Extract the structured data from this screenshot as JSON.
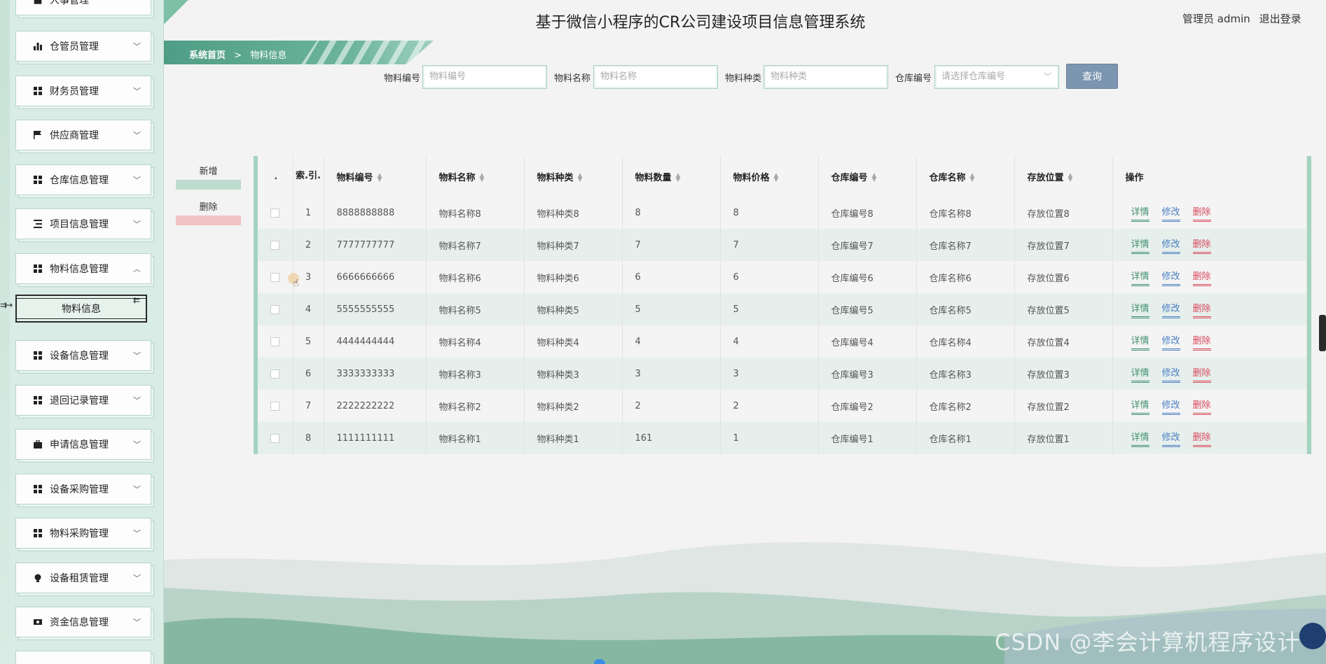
{
  "header": {
    "title": "基于微信小程序的CR公司建设项目信息管理系统",
    "user_label": "管理员 admin",
    "logout_label": "退出登录"
  },
  "breadcrumb": {
    "home": "系统首页",
    "separator": ">",
    "current": "物料信息"
  },
  "sidebar": {
    "top_partial": "人事管理",
    "items": [
      {
        "label": "仓管员管理",
        "icon": "bar-chart-icon"
      },
      {
        "label": "财务员管理",
        "icon": "grid-icon"
      },
      {
        "label": "供应商管理",
        "icon": "flag-icon"
      },
      {
        "label": "仓库信息管理",
        "icon": "grid-icon"
      },
      {
        "label": "项目信息管理",
        "icon": "list-icon"
      },
      {
        "label": "物料信息管理",
        "icon": "grid-icon"
      },
      {
        "label": "设备信息管理",
        "icon": "grid-icon"
      },
      {
        "label": "退回记录管理",
        "icon": "grid-icon"
      },
      {
        "label": "申请信息管理",
        "icon": "briefcase-icon"
      },
      {
        "label": "设备采购管理",
        "icon": "grid-icon"
      },
      {
        "label": "物料采购管理",
        "icon": "grid-icon"
      },
      {
        "label": "设备租赁管理",
        "icon": "bulb-icon"
      },
      {
        "label": "资金信息管理",
        "icon": "money-icon"
      }
    ],
    "active_sub": "物料信息"
  },
  "search": {
    "fields": [
      {
        "label": "物料编号",
        "placeholder": "物料编号"
      },
      {
        "label": "物料名称",
        "placeholder": "物料名称"
      },
      {
        "label": "物料种类",
        "placeholder": "物料种类"
      }
    ],
    "warehouse": {
      "label": "仓库编号",
      "placeholder": "请选择仓库编号"
    },
    "query_label": "查询"
  },
  "actions": {
    "add_label": "新增",
    "delete_label": "删除"
  },
  "table": {
    "check_header": ".",
    "index_header": "索.引.",
    "columns": [
      "物料编号",
      "物料名称",
      "物料种类",
      "物料数量",
      "物料价格",
      "仓库编号",
      "仓库名称",
      "存放位置"
    ],
    "op_header": "操作",
    "op_labels": {
      "detail": "详情",
      "edit": "修改",
      "delete": "删除"
    },
    "rows": [
      {
        "idx": "1",
        "code": "8888888888",
        "name": "物料名称8",
        "type": "物料种类8",
        "qty": "8",
        "price": "8",
        "wh_code": "仓库编号8",
        "wh_name": "仓库名称8",
        "loc": "存放位置8"
      },
      {
        "idx": "2",
        "code": "7777777777",
        "name": "物料名称7",
        "type": "物料种类7",
        "qty": "7",
        "price": "7",
        "wh_code": "仓库编号7",
        "wh_name": "仓库名称7",
        "loc": "存放位置7"
      },
      {
        "idx": "3",
        "code": "6666666666",
        "name": "物料名称6",
        "type": "物料种类6",
        "qty": "6",
        "price": "6",
        "wh_code": "仓库编号6",
        "wh_name": "仓库名称6",
        "loc": "存放位置6"
      },
      {
        "idx": "4",
        "code": "5555555555",
        "name": "物料名称5",
        "type": "物料种类5",
        "qty": "5",
        "price": "5",
        "wh_code": "仓库编号5",
        "wh_name": "仓库名称5",
        "loc": "存放位置5"
      },
      {
        "idx": "5",
        "code": "4444444444",
        "name": "物料名称4",
        "type": "物料种类4",
        "qty": "4",
        "price": "4",
        "wh_code": "仓库编号4",
        "wh_name": "仓库名称4",
        "loc": "存放位置4"
      },
      {
        "idx": "6",
        "code": "3333333333",
        "name": "物料名称3",
        "type": "物料种类3",
        "qty": "3",
        "price": "3",
        "wh_code": "仓库编号3",
        "wh_name": "仓库名称3",
        "loc": "存放位置3"
      },
      {
        "idx": "7",
        "code": "2222222222",
        "name": "物料名称2",
        "type": "物料种类2",
        "qty": "2",
        "price": "2",
        "wh_code": "仓库编号2",
        "wh_name": "仓库名称2",
        "loc": "存放位置2"
      },
      {
        "idx": "8",
        "code": "1111111111",
        "name": "物料名称1",
        "type": "物料种类1",
        "qty": "161",
        "price": "1",
        "wh_code": "仓库编号1",
        "wh_name": "仓库名称1",
        "loc": "存放位置1"
      }
    ]
  },
  "watermark": "CSDN @李会计算机程序设计",
  "colors": {
    "accent_green": "#4f9d85",
    "query_button": "#7c95b0",
    "detail_link": "#3f8f6e",
    "edit_link": "#4a7fc4",
    "delete_link": "#d84a5c"
  }
}
